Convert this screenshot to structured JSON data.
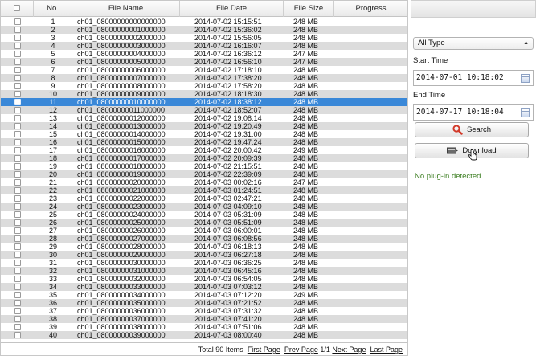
{
  "table": {
    "headers": {
      "check": "",
      "no": "No.",
      "name": "File Name",
      "date": "File Date",
      "size": "File Size",
      "progress": "Progress"
    },
    "selected_index": 10,
    "rows": [
      {
        "no": "1",
        "name": "ch01_08000000000000000",
        "date": "2014-07-02 15:15:51",
        "size": "248 MB"
      },
      {
        "no": "2",
        "name": "ch01_08000000001000000",
        "date": "2014-07-02 15:36:02",
        "size": "248 MB"
      },
      {
        "no": "3",
        "name": "ch01_08000000002000000",
        "date": "2014-07-02 15:56:05",
        "size": "248 MB"
      },
      {
        "no": "4",
        "name": "ch01_08000000003000000",
        "date": "2014-07-02 16:16:07",
        "size": "248 MB"
      },
      {
        "no": "5",
        "name": "ch01_08000000004000000",
        "date": "2014-07-02 16:36:12",
        "size": "247 MB"
      },
      {
        "no": "6",
        "name": "ch01_08000000005000000",
        "date": "2014-07-02 16:56:10",
        "size": "247 MB"
      },
      {
        "no": "7",
        "name": "ch01_08000000006000000",
        "date": "2014-07-02 17:18:10",
        "size": "248 MB"
      },
      {
        "no": "8",
        "name": "ch01_08000000007000000",
        "date": "2014-07-02 17:38:20",
        "size": "248 MB"
      },
      {
        "no": "9",
        "name": "ch01_08000000008000000",
        "date": "2014-07-02 17:58:20",
        "size": "248 MB"
      },
      {
        "no": "10",
        "name": "ch01_08000000009000000",
        "date": "2014-07-02 18:18:30",
        "size": "248 MB"
      },
      {
        "no": "11",
        "name": "ch01_08000000010000000",
        "date": "2014-07-02 18:38:12",
        "size": "248 MB"
      },
      {
        "no": "12",
        "name": "ch01_08000000011000000",
        "date": "2014-07-02 18:52:07",
        "size": "248 MB"
      },
      {
        "no": "13",
        "name": "ch01_08000000012000000",
        "date": "2014-07-02 19:08:14",
        "size": "248 MB"
      },
      {
        "no": "14",
        "name": "ch01_08000000013000000",
        "date": "2014-07-02 19:20:49",
        "size": "248 MB"
      },
      {
        "no": "15",
        "name": "ch01_08000000014000000",
        "date": "2014-07-02 19:31:00",
        "size": "248 MB"
      },
      {
        "no": "16",
        "name": "ch01_08000000015000000",
        "date": "2014-07-02 19:47:24",
        "size": "248 MB"
      },
      {
        "no": "17",
        "name": "ch01_08000000016000000",
        "date": "2014-07-02 20:00:42",
        "size": "249 MB"
      },
      {
        "no": "18",
        "name": "ch01_08000000017000000",
        "date": "2014-07-02 20:09:39",
        "size": "248 MB"
      },
      {
        "no": "19",
        "name": "ch01_08000000018000000",
        "date": "2014-07-02 21:15:51",
        "size": "248 MB"
      },
      {
        "no": "20",
        "name": "ch01_08000000019000000",
        "date": "2014-07-02 22:39:09",
        "size": "248 MB"
      },
      {
        "no": "21",
        "name": "ch01_08000000020000000",
        "date": "2014-07-03 00:02:16",
        "size": "247 MB"
      },
      {
        "no": "22",
        "name": "ch01_08000000021000000",
        "date": "2014-07-03 01:24:51",
        "size": "248 MB"
      },
      {
        "no": "23",
        "name": "ch01_08000000022000000",
        "date": "2014-07-03 02:47:21",
        "size": "248 MB"
      },
      {
        "no": "24",
        "name": "ch01_08000000023000000",
        "date": "2014-07-03 04:09:10",
        "size": "248 MB"
      },
      {
        "no": "25",
        "name": "ch01_08000000024000000",
        "date": "2014-07-03 05:31:09",
        "size": "248 MB"
      },
      {
        "no": "26",
        "name": "ch01_08000000025000000",
        "date": "2014-07-03 05:51:09",
        "size": "248 MB"
      },
      {
        "no": "27",
        "name": "ch01_08000000026000000",
        "date": "2014-07-03 06:00:01",
        "size": "248 MB"
      },
      {
        "no": "28",
        "name": "ch01_08000000027000000",
        "date": "2014-07-03 06:08:56",
        "size": "248 MB"
      },
      {
        "no": "29",
        "name": "ch01_08000000028000000",
        "date": "2014-07-03 06:18:13",
        "size": "248 MB"
      },
      {
        "no": "30",
        "name": "ch01_08000000029000000",
        "date": "2014-07-03 06:27:18",
        "size": "248 MB"
      },
      {
        "no": "31",
        "name": "ch01_08000000030000000",
        "date": "2014-07-03 06:36:25",
        "size": "248 MB"
      },
      {
        "no": "32",
        "name": "ch01_08000000031000000",
        "date": "2014-07-03 06:45:16",
        "size": "248 MB"
      },
      {
        "no": "33",
        "name": "ch01_08000000032000000",
        "date": "2014-07-03 06:54:05",
        "size": "248 MB"
      },
      {
        "no": "34",
        "name": "ch01_08000000033000000",
        "date": "2014-07-03 07:03:12",
        "size": "248 MB"
      },
      {
        "no": "35",
        "name": "ch01_08000000034000000",
        "date": "2014-07-03 07:12:20",
        "size": "249 MB"
      },
      {
        "no": "36",
        "name": "ch01_08000000035000000",
        "date": "2014-07-03 07:21:52",
        "size": "248 MB"
      },
      {
        "no": "37",
        "name": "ch01_08000000036000000",
        "date": "2014-07-03 07:31:32",
        "size": "248 MB"
      },
      {
        "no": "38",
        "name": "ch01_08000000037000000",
        "date": "2014-07-03 07:41:20",
        "size": "248 MB"
      },
      {
        "no": "39",
        "name": "ch01_08000000038000000",
        "date": "2014-07-03 07:51:06",
        "size": "248 MB"
      },
      {
        "no": "40",
        "name": "ch01_08000000039000000",
        "date": "2014-07-03 08:00:40",
        "size": "248 MB"
      }
    ]
  },
  "pagination": {
    "total_text": "Total 90 Items",
    "first_page": "First Page",
    "prev_page": "Prev Page",
    "page_indicator": "1/1",
    "next_page": "Next Page",
    "last_page": "Last Page"
  },
  "search_panel": {
    "type_select_value": "All Type",
    "start_time_label": "Start Time",
    "start_time_value": "2014-07-01 10:18:02",
    "end_time_label": "End Time",
    "end_time_value": "2014-07-17 10:18:04",
    "search_button_label": "Search",
    "download_button_label": "Download",
    "status_text": "No plug-in detected."
  },
  "colors": {
    "selected_row": "#3a88d8",
    "stripe_row": "#dcdcdc",
    "status_green": "#3a7d1f",
    "search_icon": "#d23a2a"
  }
}
